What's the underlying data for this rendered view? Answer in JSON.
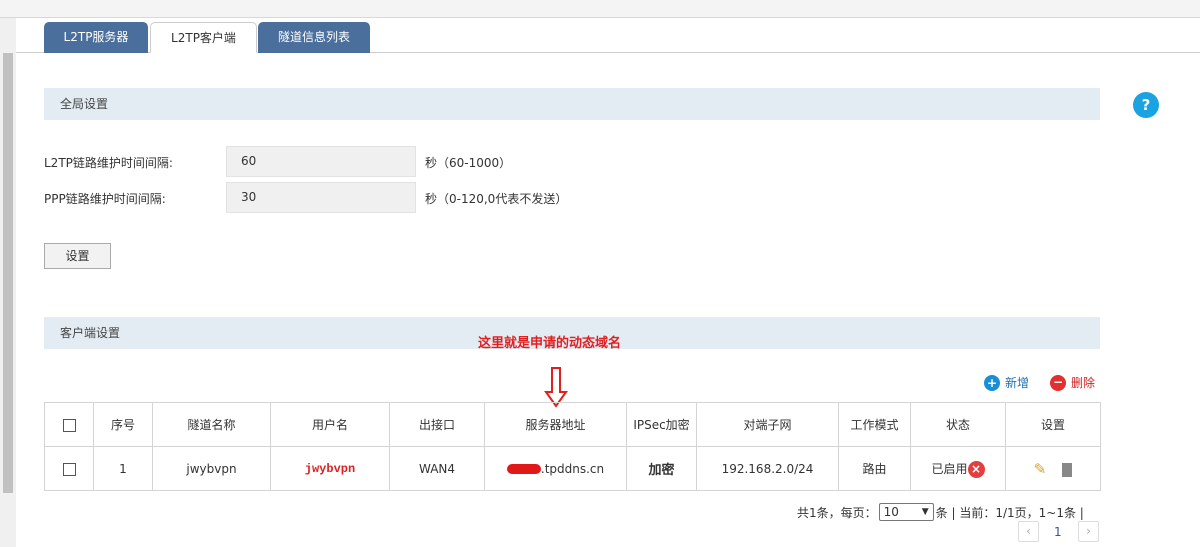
{
  "tabs": [
    {
      "label": "L2TP服务器"
    },
    {
      "label": "L2TP客户端"
    },
    {
      "label": "隧道信息列表"
    }
  ],
  "global": {
    "title": "全局设置",
    "l2tp_label": "L2TP链路维护时间间隔:",
    "l2tp_value": "60",
    "l2tp_hint": "秒（60-1000）",
    "ppp_label": "PPP链路维护时间间隔:",
    "ppp_value": "30",
    "ppp_hint": "秒（0-120,0代表不发送）",
    "set_button": "设置"
  },
  "client": {
    "title": "客户端设置",
    "annotation": "这里就是申请的动态域名",
    "add": "新增",
    "delete": "删除",
    "columns": [
      "序号",
      "隧道名称",
      "用户名",
      "出接口",
      "服务器地址",
      "IPSec加密",
      "对端子网",
      "工作模式",
      "状态",
      "设置"
    ],
    "rows": [
      {
        "index": "1",
        "tunnel": "jwybvpn",
        "user": "jwybvpn",
        "iface": "WAN4",
        "server": ".tpddns.cn",
        "ipsec": "加密",
        "subnet": "192.168.2.0/24",
        "mode": "路由",
        "status": "已启用"
      }
    ]
  },
  "pagination": {
    "total": "共1条，每页：",
    "per_page": "10",
    "suffix": "条 | 当前：1/1页，1~1条 |",
    "page": "1"
  },
  "colors": {
    "tab": "#4a6f9c",
    "section": "#e3ecf3",
    "annotation": "#e02020",
    "add": "#1a8fd8",
    "delete": "#e03030"
  }
}
